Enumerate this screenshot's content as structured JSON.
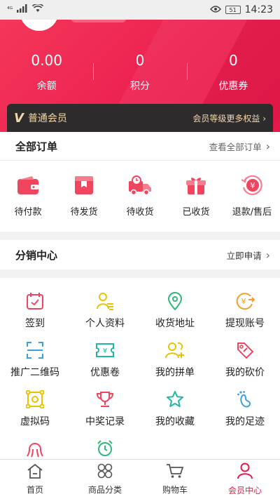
{
  "status_bar": {
    "network": "⁴ᴳ",
    "battery": "51",
    "time": "14:23"
  },
  "colors": {
    "brand": "#ec2150",
    "gold": "#f3d7a8",
    "dark": "#2e2b2c"
  },
  "stats": [
    {
      "value": "0.00",
      "label": "余额"
    },
    {
      "value": "0",
      "label": "积分"
    },
    {
      "value": "0",
      "label": "优惠券"
    }
  ],
  "member": {
    "badge": "V",
    "level": "普通会员",
    "more": "会员等级更多权益"
  },
  "orders": {
    "title": "全部订单",
    "view_all": "查看全部订单",
    "items": [
      {
        "label": "待付款",
        "icon": "wallet-icon"
      },
      {
        "label": "待发货",
        "icon": "package-icon"
      },
      {
        "label": "待收货",
        "icon": "truck-icon"
      },
      {
        "label": "已收货",
        "icon": "gift-icon"
      },
      {
        "label": "退款/售后",
        "icon": "refund-icon"
      }
    ]
  },
  "distribution": {
    "title": "分销中心",
    "apply": "立即申请"
  },
  "grid": [
    {
      "label": "签到",
      "icon": "calendar-check-icon"
    },
    {
      "label": "个人资料",
      "icon": "profile-doc-icon"
    },
    {
      "label": "收货地址",
      "icon": "location-pin-icon"
    },
    {
      "label": "提现账号",
      "icon": "withdraw-coin-icon"
    },
    {
      "label": "推广二维码",
      "icon": "qr-scan-icon"
    },
    {
      "label": "优惠卷",
      "icon": "coupon-icon"
    },
    {
      "label": "我的拼单",
      "icon": "group-buy-icon"
    },
    {
      "label": "我的砍价",
      "icon": "price-tag-icon"
    },
    {
      "label": "虚拟码",
      "icon": "virtual-code-icon"
    },
    {
      "label": "中奖记录",
      "icon": "trophy-icon"
    },
    {
      "label": "我的收藏",
      "icon": "star-icon"
    },
    {
      "label": "我的足迹",
      "icon": "footprint-icon"
    },
    {
      "label": "",
      "icon": "octopus-icon"
    },
    {
      "label": "",
      "icon": "alarm-clock-icon"
    }
  ],
  "nav": [
    {
      "label": "首页",
      "icon": "home-icon"
    },
    {
      "label": "商品分类",
      "icon": "category-icon"
    },
    {
      "label": "购物车",
      "icon": "cart-icon"
    },
    {
      "label": "会员中心",
      "icon": "user-icon"
    }
  ]
}
